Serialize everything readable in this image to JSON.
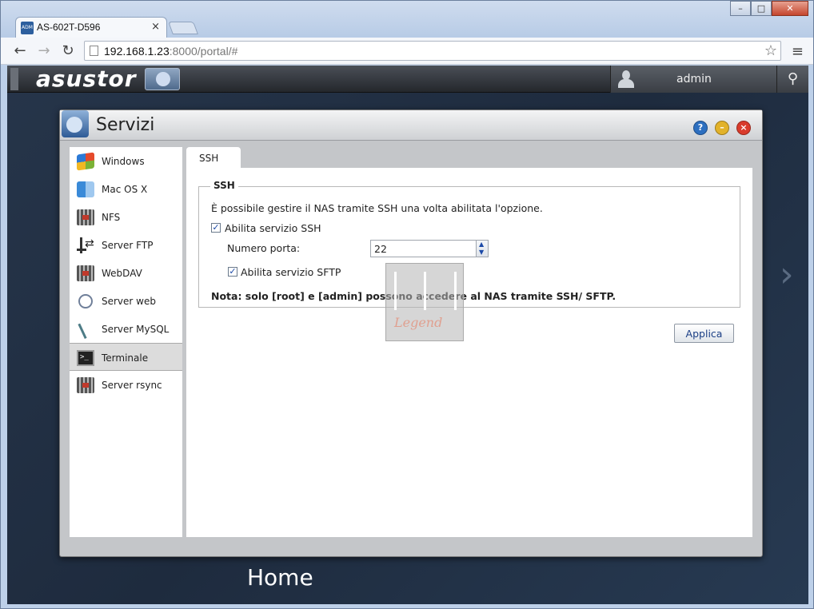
{
  "browser": {
    "tab_title": "AS-602T-D596",
    "tab_close": "×",
    "favicon_text": "ADM",
    "url_host": "192.168.1.23",
    "url_rest": ":8000/portal/#",
    "back": "←",
    "forward": "→",
    "reload": "↻",
    "star": "☆",
    "menu": "≡",
    "win_min": "–",
    "win_max": "□",
    "win_close": "✕"
  },
  "appbar": {
    "logo": "asustor",
    "username": "admin",
    "search": "⚲"
  },
  "dialog": {
    "title": "Servizi",
    "help": "?",
    "minimize": "–",
    "close": "×"
  },
  "sidebar": {
    "items": [
      {
        "label": "Windows",
        "icon": "windows-icon"
      },
      {
        "label": "Mac OS X",
        "icon": "mac-icon"
      },
      {
        "label": "NFS",
        "icon": "nfs-server-icon"
      },
      {
        "label": "Server FTP",
        "icon": "ftp-icon"
      },
      {
        "label": "WebDAV",
        "icon": "webdav-server-icon"
      },
      {
        "label": "Server web",
        "icon": "web-server-icon"
      },
      {
        "label": "Server MySQL",
        "icon": "mysql-icon"
      },
      {
        "label": "Terminale",
        "icon": "terminal-icon",
        "active": true
      },
      {
        "label": "Server rsync",
        "icon": "rsync-server-icon"
      }
    ]
  },
  "ssh": {
    "tab_label": "SSH",
    "legend": "SSH",
    "description": "È possibile gestire il NAS tramite SSH una volta abilitata l'opzione.",
    "enable_ssh_label": "Abilita servizio SSH",
    "enable_ssh_checked": true,
    "port_label": "Numero porta:",
    "port_value": "22",
    "enable_sftp_label": "Abilita servizio SFTP",
    "enable_sftp_checked": true,
    "note": "Nota: solo [root] e [admin] possono accedere al NAS tramite SSH/ SFTP.",
    "apply_label": "Applica"
  },
  "watermark": {
    "text": "Legend"
  },
  "desktop": {
    "home_label": "Home",
    "next_arrow": "›"
  }
}
